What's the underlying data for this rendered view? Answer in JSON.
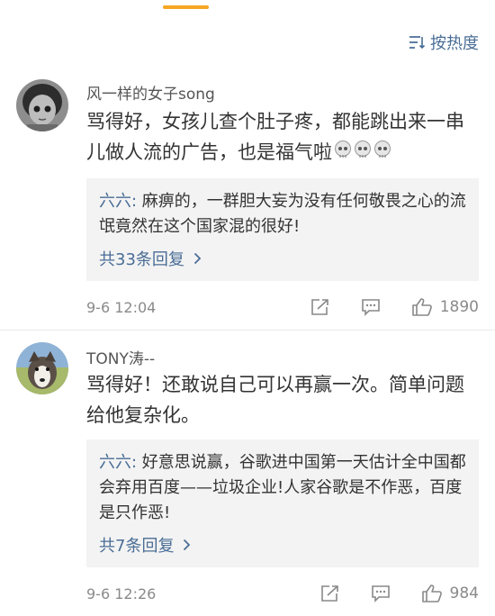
{
  "sort": {
    "label": "按热度"
  },
  "comments": [
    {
      "username": "风一样的女子song",
      "content": "骂得好，女孩儿查个肚子疼，都能跳出来一串儿做人流的广告，也是福气啦",
      "reply": {
        "author": "六六:",
        "text": " 麻痹的，一群胆大妄为没有任何敬畏之心的流氓竟然在这个国家混的很好!",
        "more": "共33条回复"
      },
      "time": "9-6 12:04",
      "likes": "1890"
    },
    {
      "username": "TONY涛--",
      "content": "骂得好！还敢说自己可以再赢一次。简单问题给他复杂化。",
      "reply": {
        "author": "六六:",
        "text": " 好意思说赢，谷歌进中国第一天估计全中国都会弃用百度——垃圾企业!人家谷歌是不作恶，百度是只作恶!",
        "more": "共7条回复"
      },
      "time": "9-6 12:26",
      "likes": "984"
    }
  ]
}
